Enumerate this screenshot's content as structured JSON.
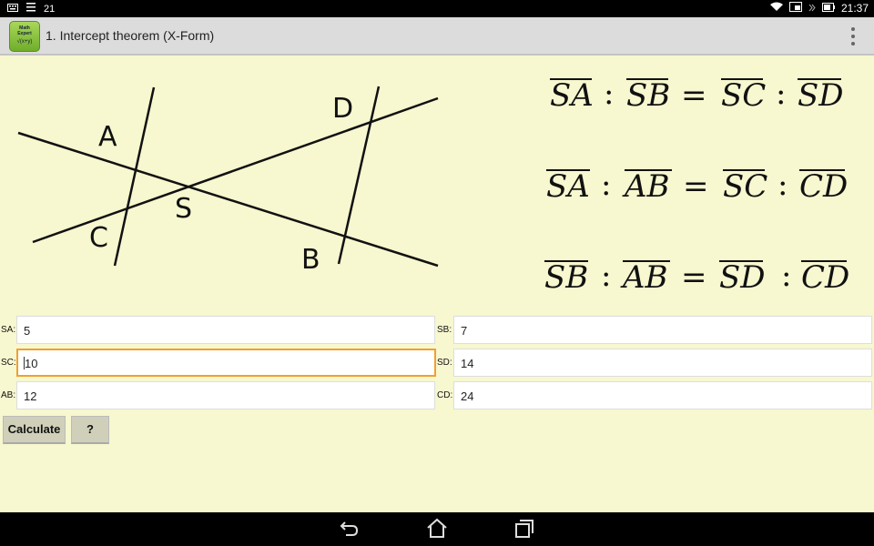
{
  "status_bar": {
    "notification_number": "21",
    "clock": "21:37"
  },
  "app": {
    "icon_text_line1": "Math",
    "icon_text_line2": "Expert",
    "icon_formula": "√(x+y)",
    "title": "1. Intercept theorem (X-Form)"
  },
  "diagram": {
    "labels": {
      "A": "A",
      "B": "B",
      "C": "C",
      "D": "D",
      "S": "S"
    }
  },
  "formulas": [
    {
      "a": "SA",
      "b": "SB",
      "c": "SC",
      "d": "SD"
    },
    {
      "a": "SA",
      "b": "AB",
      "c": "SC",
      "d": "CD"
    },
    {
      "a": "SB",
      "b": "AB",
      "c": "SD",
      "d": "CD"
    }
  ],
  "fields": {
    "sa": {
      "label": "SA:",
      "value": "5"
    },
    "sb": {
      "label": "SB:",
      "value": "7"
    },
    "sc": {
      "label": "SC:",
      "value": "10"
    },
    "sd": {
      "label": "SD:",
      "value": "14"
    },
    "ab": {
      "label": "AB:",
      "value": "12"
    },
    "cd": {
      "label": "CD:",
      "value": "24"
    }
  },
  "buttons": {
    "calculate": "Calculate",
    "help": "?"
  }
}
